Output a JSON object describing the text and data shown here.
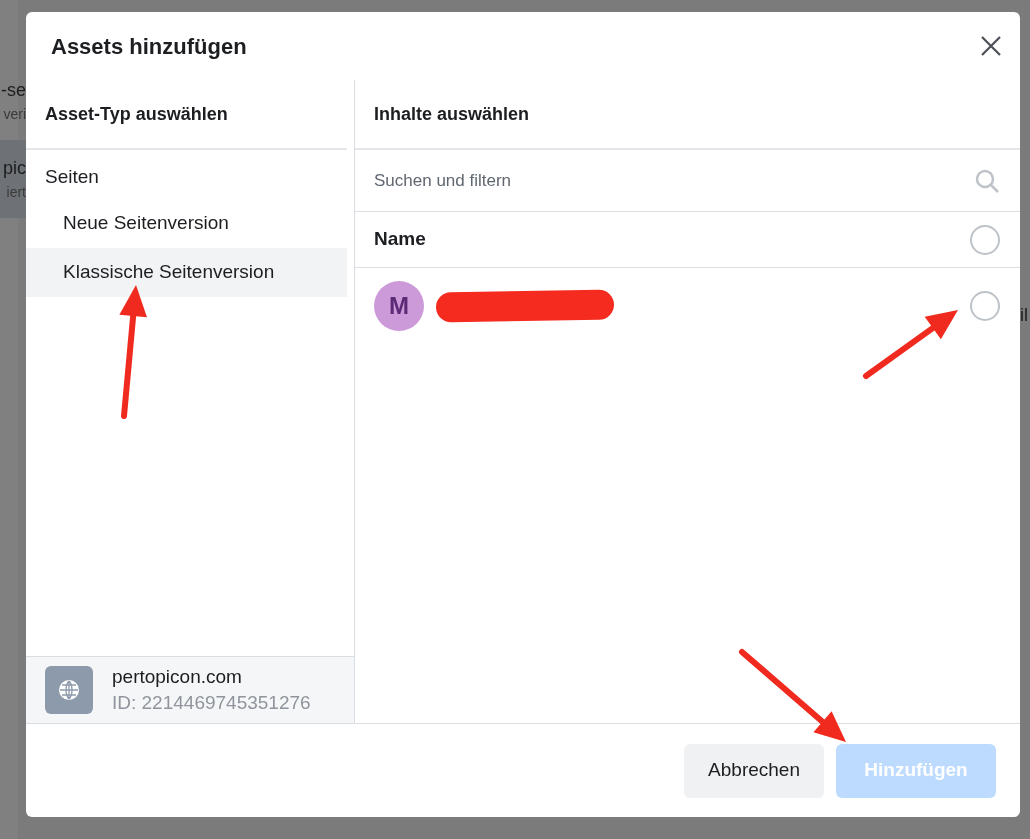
{
  "background": {
    "left_items": [
      {
        "title": "-se",
        "subtitle": "veri",
        "selected": false
      },
      {
        "title": "pic",
        "subtitle": "iert",
        "selected": true
      }
    ],
    "right_fragment": "il"
  },
  "dialog": {
    "title": "Assets hinzufügen",
    "asset_types": {
      "heading": "Asset-Typ auswählen",
      "group": "Seiten",
      "items": [
        {
          "label": "Neue Seitenversion",
          "selected": false
        },
        {
          "label": "Klassische Seitenversion",
          "selected": true
        }
      ]
    },
    "business": {
      "name": "pertopicon.com",
      "id": "ID: 2214469745351276"
    },
    "content": {
      "heading": "Inhalte auswählen",
      "search": {
        "placeholder": "Suchen und filtern"
      },
      "column": "Name",
      "select_all": {
        "selected": false
      },
      "assets": [
        {
          "initial": "M",
          "redacted": true,
          "selected": false
        }
      ]
    },
    "buttons": [
      {
        "label": "Abbrechen",
        "kind": "secondary",
        "disabled": false
      },
      {
        "label": "Hinzufügen",
        "kind": "primary",
        "disabled": true
      }
    ]
  }
}
